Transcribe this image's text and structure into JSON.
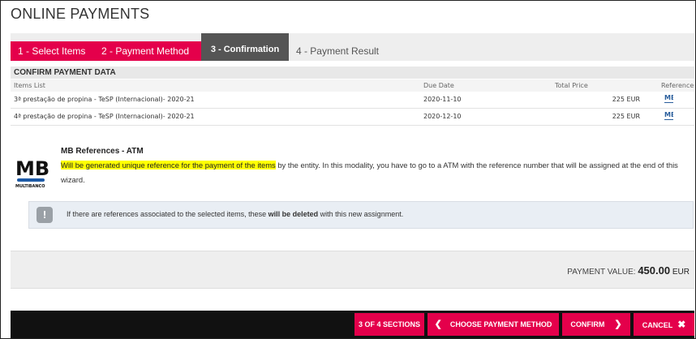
{
  "page": {
    "title": "ONLINE PAYMENTS"
  },
  "tabs": [
    {
      "label": "1 - Select Items"
    },
    {
      "label": "2 - Payment Method"
    },
    {
      "label": "3 - Confirmation"
    },
    {
      "label": "4 - Payment Result"
    }
  ],
  "section": {
    "title": "CONFIRM PAYMENT DATA"
  },
  "table": {
    "columns": [
      "Items List",
      "Due Date",
      "Total Price",
      "Reference"
    ],
    "rows": [
      {
        "item": "3ª prestação de propina - TeSP (Internacional)- 2020-21",
        "due": "2020-11-10",
        "price": "225 EUR",
        "ref_icon": "mb-reference-icon"
      },
      {
        "item": "4ª prestação de propina - TeSP (Internacional)- 2020-21",
        "due": "2020-12-10",
        "price": "225 EUR",
        "ref_icon": "mb-reference-icon"
      }
    ]
  },
  "mb": {
    "logo_text": "MB",
    "logo_subtext": "MULTIBANCO",
    "title": "MB References - ATM",
    "highlight": "Will be generated unique reference for the payment of the items",
    "text_rest": " by the entity. In this modality, you have to go to a ATM with the reference number that will be assigned at the end of this wizard."
  },
  "note": {
    "icon": "exclamation-icon",
    "text_before": "If there are references associated to the selected items, these ",
    "text_bold": "will be deleted",
    "text_after": " with this new assignment."
  },
  "payment": {
    "label": "PAYMENT VALUE: ",
    "value": "450.00",
    "currency": " EUR"
  },
  "footer": {
    "sections": "3 OF 4 SECTIONS",
    "back": "CHOOSE PAYMENT METHOD",
    "confirm": "CONFIRM",
    "cancel": "CANCEL"
  },
  "colors": {
    "accent": "#e4004b",
    "active_tab": "#555555",
    "highlight": "#ffff00"
  }
}
